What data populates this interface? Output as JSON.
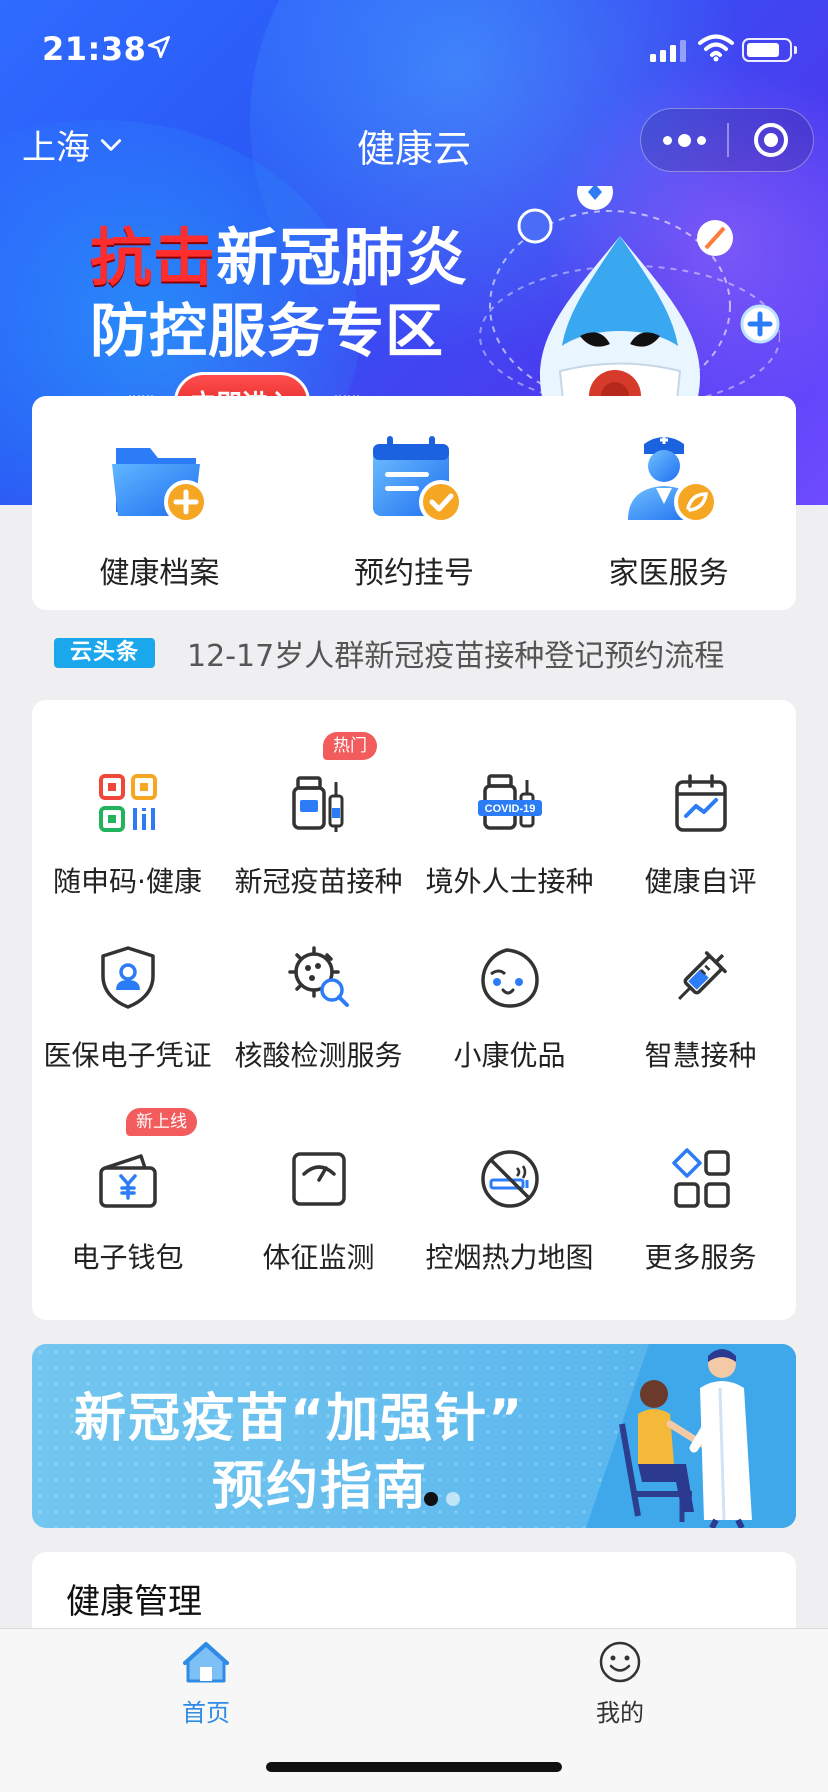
{
  "status": {
    "time": "21:38"
  },
  "nav": {
    "city": "上海",
    "title": "健康云"
  },
  "banner": {
    "line1_red": "抗击",
    "line1_white": "新冠肺炎",
    "line2": "防控服务专区",
    "button": "立即进入"
  },
  "quick_actions": [
    {
      "label": "健康档案",
      "icon": "folder-plus-icon"
    },
    {
      "label": "预约挂号",
      "icon": "calendar-check-icon"
    },
    {
      "label": "家医服务",
      "icon": "doctor-icon"
    }
  ],
  "ticker": {
    "badge": "云头条",
    "text": "12-17岁人群新冠疫苗接种登记预约流程"
  },
  "services": [
    {
      "label": "随申码·健康",
      "icon": "qr-code-icon",
      "tag": ""
    },
    {
      "label": "新冠疫苗接种",
      "icon": "vaccine-bottle-icon",
      "tag": "热门"
    },
    {
      "label": "境外人士接种",
      "icon": "covid-vaccine-icon",
      "tag": ""
    },
    {
      "label": "健康自评",
      "icon": "calendar-chart-icon",
      "tag": ""
    },
    {
      "label": "医保电子凭证",
      "icon": "shield-badge-icon",
      "tag": ""
    },
    {
      "label": "核酸检测服务",
      "icon": "virus-search-icon",
      "tag": ""
    },
    {
      "label": "小康优品",
      "icon": "mascot-face-icon",
      "tag": ""
    },
    {
      "label": "智慧接种",
      "icon": "syringe-icon",
      "tag": ""
    },
    {
      "label": "电子钱包",
      "icon": "wallet-icon",
      "tag": "新上线"
    },
    {
      "label": "体征监测",
      "icon": "scale-icon",
      "tag": ""
    },
    {
      "label": "控烟热力地图",
      "icon": "no-smoking-icon",
      "tag": ""
    },
    {
      "label": "更多服务",
      "icon": "grid-more-icon",
      "tag": ""
    }
  ],
  "promo": {
    "line1": "新冠疫苗“加强针”",
    "line2": "预约指南",
    "page_count": 2,
    "active_page": 1
  },
  "health": {
    "title": "健康管理"
  },
  "tabbar": {
    "items": [
      {
        "label": "首页",
        "active": true,
        "icon": "home-icon"
      },
      {
        "label": "我的",
        "active": false,
        "icon": "smiley-icon"
      }
    ]
  },
  "colors": {
    "accent": "#1a73e8",
    "blue_icon": "#2b7cf6",
    "orange_icon": "#f5a623",
    "tag_red": "#f25c5c",
    "ticker_blue": "#1aa7ec",
    "tab_active": "#2f8be6"
  }
}
